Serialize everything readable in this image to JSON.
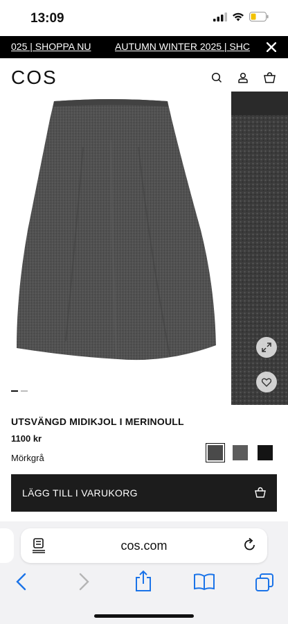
{
  "status_bar": {
    "time": "13:09"
  },
  "promo": {
    "text_left": "025 | SHOPPA NU",
    "text_right": "AUTUMN WINTER 2025 | SHC",
    "close_icon": "close-icon"
  },
  "header": {
    "logo": "COS",
    "icons": [
      "search-icon",
      "account-icon",
      "bag-icon"
    ]
  },
  "gallery": {
    "slides": 2,
    "active_slide": 1,
    "expand_icon": "expand-icon",
    "wishlist_icon": "heart-icon"
  },
  "product": {
    "name": "UTSVÄNGD MIDIKJOL I MERINOULL",
    "price": "1100 kr",
    "color_name": "Mörkgrå",
    "swatches": [
      {
        "name": "Mörkgrå",
        "color": "#4a4a4a",
        "selected": true
      },
      {
        "name": "Grå",
        "color": "#5c5c5c",
        "selected": false
      },
      {
        "name": "Svart",
        "color": "#141414",
        "selected": false
      }
    ],
    "add_to_cart_label": "LÄGG TILL I VARUKORG"
  },
  "browser": {
    "url": "cos.com",
    "toolbar_icons": [
      "back-icon",
      "forward-icon",
      "share-icon",
      "bookmarks-icon",
      "tabs-icon"
    ]
  },
  "colors": {
    "accent_blue": "#1a73e8",
    "button_dark": "#1c1c1c",
    "skirt_gray": "#4b4b4b"
  }
}
